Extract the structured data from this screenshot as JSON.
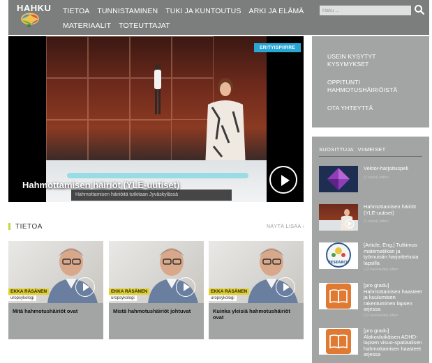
{
  "logo": {
    "text": "HAHKU"
  },
  "nav": {
    "row1": [
      "TIETOA",
      "TUNNISTAMINEN",
      "TUKI JA KUNTOUTUS",
      "ARKI JA ELÄMÄ"
    ],
    "row2": [
      "MATERIAALIT",
      "TOTEUTTAJAT"
    ]
  },
  "search": {
    "placeholder": "Haku ..."
  },
  "hero": {
    "badge": "ERITYISPIIRRE",
    "title": "Hahmottamisen häiriöt (YLE-uutiset)",
    "ticker": "Hahmottamisen häiriöitä tutkitaan Jyväskylässä"
  },
  "side_links": [
    "USEIN KYSYTYT KYSYMYKSET",
    "OPPITUNTI HAHMOTUSHÄIRIÖISTÄ",
    "OTA YHTEYTTÄ"
  ],
  "section": {
    "title": "TIETOA",
    "show_more": "NÄYTÄ LISÄÄ ›"
  },
  "cards": [
    {
      "caption_name": "EKKA RÄSÄNEN",
      "caption_role": "uropsykologi",
      "title": "Mitä hahmotushäiriöt ovat"
    },
    {
      "caption_name": "EKKA RÄSÄNEN",
      "caption_role": "uropsykologi",
      "title": "Mistä hahmotushäiriöt johtuvat"
    },
    {
      "caption_name": "EKKA RÄSÄNEN",
      "caption_role": "uropsykologi",
      "title": "Kuinka yleisiä hahmotushäiriöt ovat"
    }
  ],
  "popular": {
    "tabs": [
      "SUOSITTUJA",
      "VIIMEISET"
    ],
    "items": [
      {
        "title": "Vektor-harjoituspeli",
        "time": "(1 vuosi) sitten",
        "thumb": "diamond"
      },
      {
        "title": "Hahmottamisen häiriöt (YLE-uutiset)",
        "time": "(1 vuosi) sitten",
        "thumb": "video"
      },
      {
        "title": "[Article, Eng.] Tutkimus matematiikan ja työmuistin harjoittelusta lapsilla",
        "time": "(12 kuukautta) sitten",
        "thumb": "research",
        "thumb_label": "RESEARCH"
      },
      {
        "title": "[pro gradu] Hahmottamisen haasteet ja kuulumisen rakentuminen lapsen arjessa",
        "time": "(12 kuukautta) sitten",
        "thumb": "book"
      },
      {
        "title": "[pro gradu] Alakouluikäisen ADHD-lapsen visuo-spatiaalisen hahmottamisen haasteet arjessa",
        "time": "",
        "thumb": "book"
      }
    ]
  },
  "colors": {
    "header_bg": "#7c7e7e",
    "panel_bg": "#a3a5a4",
    "accent_blue": "#2aa6d4",
    "accent_yellow": "#c6d63a",
    "book_orange": "#e07a32"
  }
}
